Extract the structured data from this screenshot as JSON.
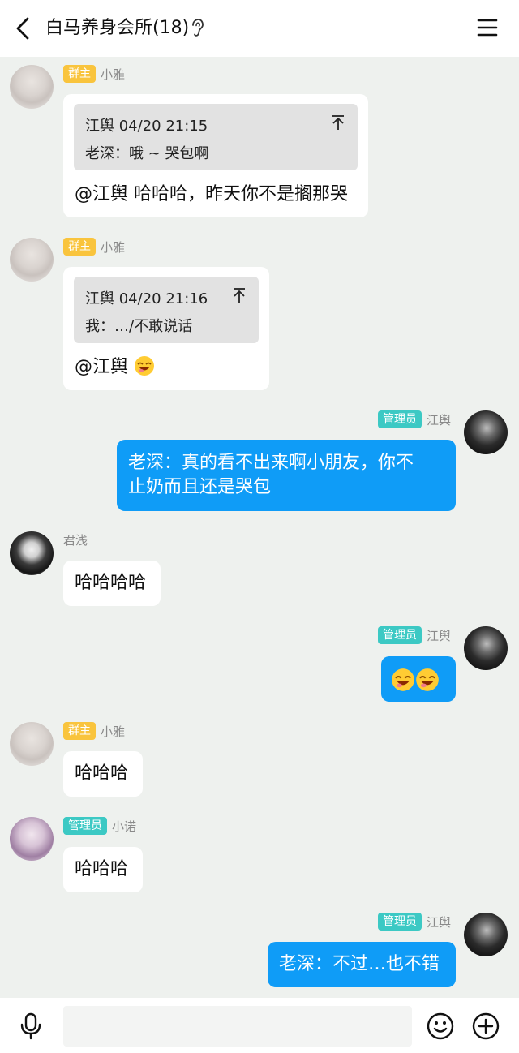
{
  "header": {
    "title": "白马养身会所(18)"
  },
  "messages": [
    {
      "sender": "小雅",
      "role": "群主",
      "quote": {
        "header": "江舆 04/20 21:15",
        "body": "老深：哦 ~ 哭包啊"
      },
      "text": "@江舆 哈哈哈，昨天你不是搁那哭"
    },
    {
      "sender": "小雅",
      "role": "群主",
      "quote": {
        "header": "江舆 04/20 21:16",
        "body": "我：…/不敢说话"
      },
      "text": "@江舆"
    },
    {
      "sender": "江舆",
      "role": "管理员",
      "text_line1": "老深：真的看不出来啊小朋友，你不",
      "text_line2": "止奶而且还是哭包"
    },
    {
      "sender": "君浅",
      "text": "哈哈哈哈"
    },
    {
      "sender": "江舆",
      "role": "管理员"
    },
    {
      "sender": "小雅",
      "role": "群主",
      "text": "哈哈哈"
    },
    {
      "sender": "小诺",
      "role": "管理员",
      "text": "哈哈哈"
    },
    {
      "sender": "江舆",
      "role": "管理员",
      "text": "老深：不过…也不错"
    }
  ],
  "colors": {
    "outgoing_bubble": "#0f9cf7",
    "owner_badge": "#f9c43d",
    "admin_badge": "#3cc9c4",
    "background": "#eef1ee"
  },
  "icons": {
    "back": "back-arrow-icon",
    "ear": "ear-icon",
    "menu": "menu-icon",
    "pin": "pin-to-top-icon",
    "emoji": "laughing-emoji-icon",
    "mic": "microphone-icon",
    "sticker": "smiley-icon",
    "more": "plus-icon"
  }
}
